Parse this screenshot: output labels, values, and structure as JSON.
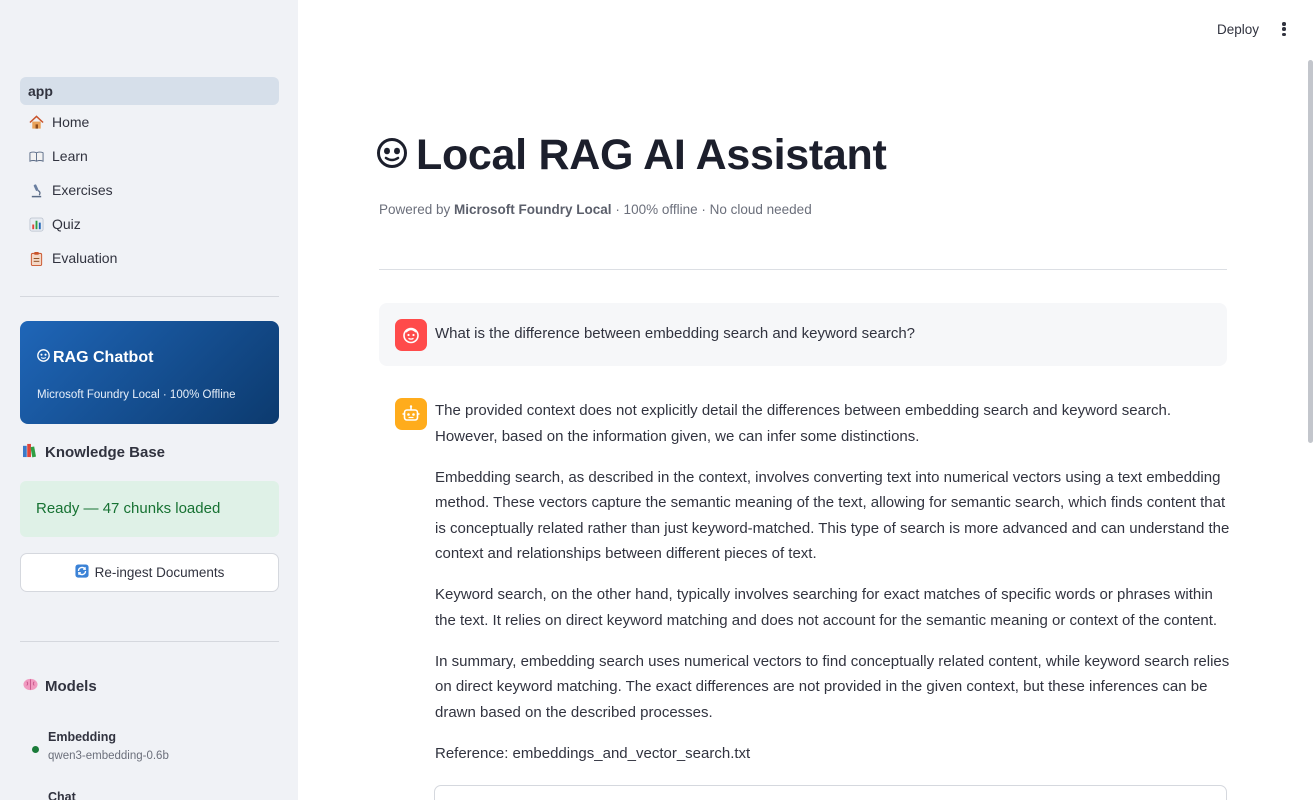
{
  "sidebar": {
    "nav_header": "app",
    "nav_items": [
      {
        "label": "Home",
        "icon": "house-icon"
      },
      {
        "label": "Learn",
        "icon": "book-icon"
      },
      {
        "label": "Exercises",
        "icon": "microscope-icon"
      },
      {
        "label": "Quiz",
        "icon": "bar-chart-icon"
      },
      {
        "label": "Evaluation",
        "icon": "clipboard-icon"
      }
    ],
    "banner": {
      "title": "RAG Chatbot",
      "subtitle": "Microsoft Foundry Local · 100% Offline",
      "icon": "robot-face-icon"
    },
    "knowledge_base": {
      "title": "Knowledge Base",
      "icon": "books-icon",
      "status": "Ready — 47 chunks loaded",
      "reingest_label": "Re-ingest Documents",
      "reingest_icon": "refresh-icon"
    },
    "models": {
      "title": "Models",
      "icon": "brain-icon",
      "items": [
        {
          "name": "Embedding",
          "id": "qwen3-embedding-0.6b",
          "status_color": "#1a7b39"
        },
        {
          "name": "Chat",
          "id": "",
          "status_color": "#1a7b39"
        }
      ]
    }
  },
  "header": {
    "deploy_label": "Deploy"
  },
  "main": {
    "title": "Local RAG AI Assistant",
    "title_icon": "robot-face-icon",
    "subtitle_prefix": "Powered by ",
    "subtitle_bold": "Microsoft Foundry Local",
    "subtitle_suffix": " · 100% offline · No cloud needed"
  },
  "chat": {
    "user_message": "What is the difference between embedding search and keyword search?",
    "assistant_paragraphs": [
      "The provided context does not explicitly detail the differences between embedding search and keyword search. However, based on the information given, we can infer some distinctions.",
      "Embedding search, as described in the context, involves converting text into numerical vectors using a text embedding method. These vectors capture the semantic meaning of the text, allowing for semantic search, which finds content that is conceptually related rather than just keyword-matched. This type of search is more advanced and can understand the context and relationships between different pieces of text.",
      "Keyword search, on the other hand, typically involves searching for exact matches of specific words or phrases within the text. It relies on direct keyword matching and does not account for the semantic meaning or context of the content.",
      "In summary, embedding search uses numerical vectors to find conceptually related content, while keyword search relies on direct keyword matching. The exact differences are not provided in the given context, but these inferences can be drawn based on the described processes.",
      "Reference: embeddings_and_vector_search.txt"
    ]
  },
  "colors": {
    "user_avatar": "#ff4b4b",
    "assistant_avatar": "#ffac1c",
    "banner_start": "#1f66b8",
    "banner_end": "#0c3a6e",
    "ready_bg": "#dff1e7",
    "ready_text": "#177233"
  }
}
